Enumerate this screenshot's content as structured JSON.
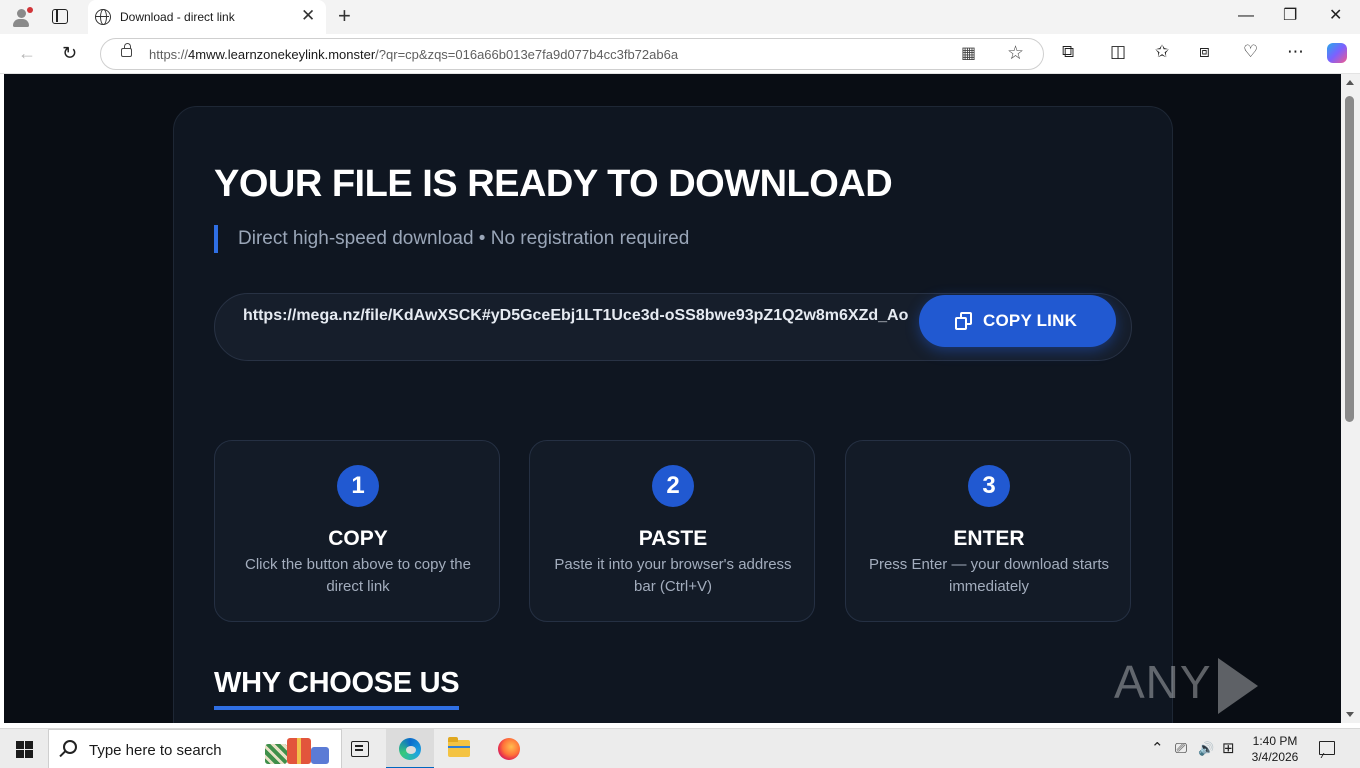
{
  "browser": {
    "tab_title": "Download - direct link",
    "tab_close_glyph": "✕",
    "new_tab_glyph": "+",
    "url_prefix": "https://",
    "url_host": "4mww.learnzonekeylink.monster",
    "url_rest": "/?qr=cp&zqs=016a66b013e7fa9d077b4cc3fb72ab6a",
    "back_glyph": "←",
    "reload_glyph": "↻",
    "minimize_glyph": "—",
    "restore_glyph": "❐",
    "close_glyph": "✕",
    "icons": {
      "profile": "profile-icon",
      "tab_actions": "tab-actions-icon",
      "site_info": "lock-icon",
      "read_mode": "read-mode-icon",
      "favorite": "star-icon",
      "extensions": "puzzle-icon",
      "split_screen": "split-screen-icon",
      "favorites_bar": "favorites-icon",
      "collections": "collections-icon",
      "performance": "heart-pulse-icon",
      "more": "more-icon",
      "copilot": "copilot-icon"
    },
    "glyphs": {
      "read_mode": "▦",
      "favorite": "☆",
      "extensions": "⧉",
      "split_screen": "◫",
      "favorites_bar": "✩",
      "collections": "⧈",
      "performance": "♡",
      "more": "⋯"
    }
  },
  "page": {
    "headline": "YOUR FILE IS READY TO DOWNLOAD",
    "subline": "Direct high-speed download • No registration required",
    "link": "https://mega.nz/file/KdAwXSCK#yD5GceEbj1LT1Uce3d-oSS8bwe93pZ1Q2w8m6XZd_Ao",
    "copy_button_label": "COPY LINK",
    "steps": [
      {
        "number": "1",
        "title": "COPY",
        "description": "Click the button above to copy the direct link"
      },
      {
        "number": "2",
        "title": "PASTE",
        "description": "Paste it into your browser's address bar (Ctrl+V)"
      },
      {
        "number": "3",
        "title": "ENTER",
        "description": "Press Enter — your download starts immediately"
      }
    ],
    "why_heading": "WHY CHOOSE US",
    "accent_color": "#2159d1",
    "background_color": "#090d14"
  },
  "watermark": {
    "left": "ANY",
    "right": "RUN"
  },
  "taskbar": {
    "search_placeholder": "Type here to search",
    "apps": [
      "task-view-icon",
      "edge-icon",
      "file-explorer-icon",
      "firefox-icon"
    ],
    "tray": {
      "chevron_glyph": "⌃",
      "meet_glyph": "⎚",
      "volume_glyph": "🔊",
      "network_glyph": "⊞"
    },
    "time": "1:40 PM",
    "date": "3/4/2026"
  }
}
